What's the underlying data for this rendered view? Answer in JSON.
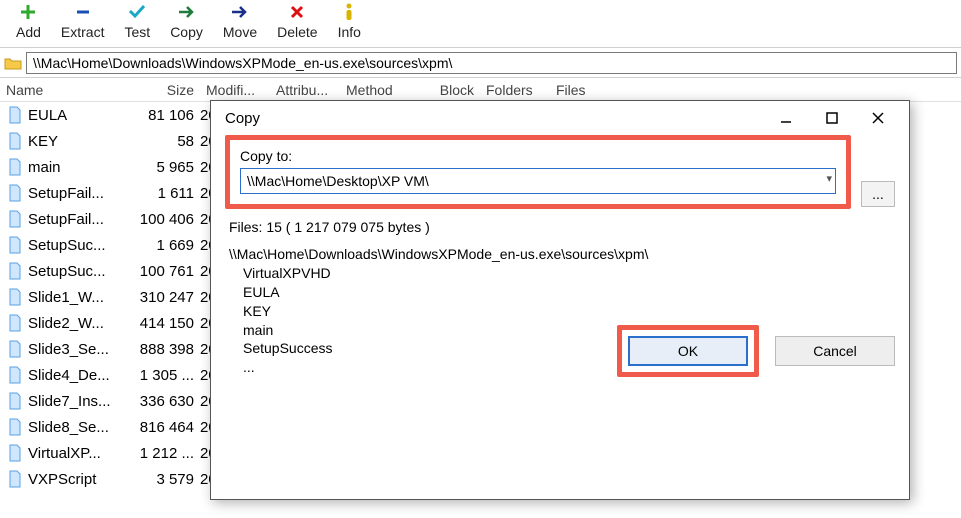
{
  "toolbar": {
    "add": "Add",
    "extract": "Extract",
    "test": "Test",
    "copy": "Copy",
    "move": "Move",
    "delete": "Delete",
    "info": "Info"
  },
  "address": "\\\\Mac\\Home\\Downloads\\WindowsXPMode_en-us.exe\\sources\\xpm\\",
  "columns": {
    "name": "Name",
    "size": "Size",
    "modified": "Modifi...",
    "attributes": "Attribu...",
    "method": "Method",
    "block": "Block",
    "folders": "Folders",
    "files": "Files"
  },
  "rows": [
    {
      "name": "EULA",
      "size": "81 106",
      "mod": "20"
    },
    {
      "name": "KEY",
      "size": "58",
      "mod": "20"
    },
    {
      "name": "main",
      "size": "5 965",
      "mod": "20"
    },
    {
      "name": "SetupFail...",
      "size": "1 611",
      "mod": "20"
    },
    {
      "name": "SetupFail...",
      "size": "100 406",
      "mod": "20"
    },
    {
      "name": "SetupSuc...",
      "size": "1 669",
      "mod": "20"
    },
    {
      "name": "SetupSuc...",
      "size": "100 761",
      "mod": "20"
    },
    {
      "name": "Slide1_W...",
      "size": "310 247",
      "mod": "20"
    },
    {
      "name": "Slide2_W...",
      "size": "414 150",
      "mod": "20"
    },
    {
      "name": "Slide3_Se...",
      "size": "888 398",
      "mod": "20"
    },
    {
      "name": "Slide4_De...",
      "size": "1 305 ...",
      "mod": "20"
    },
    {
      "name": "Slide7_Ins...",
      "size": "336 630",
      "mod": "20"
    },
    {
      "name": "Slide8_Se...",
      "size": "816 464",
      "mod": "20"
    },
    {
      "name": "VirtualXP...",
      "size": "1 212 ...",
      "mod": "20"
    },
    {
      "name": "VXPScript",
      "size": "3 579",
      "mod": "20"
    }
  ],
  "dialog": {
    "title": "Copy",
    "copy_to_label": "Copy to:",
    "copy_to_value": "\\\\Mac\\Home\\Desktop\\XP VM\\",
    "browse": "...",
    "summary": "Files: 15    ( 1 217 079 075 bytes )",
    "source_path": "\\\\Mac\\Home\\Downloads\\WindowsXPMode_en-us.exe\\sources\\xpm\\",
    "items": [
      "VirtualXPVHD",
      "EULA",
      "KEY",
      "main",
      "SetupSuccess",
      "..."
    ],
    "ok": "OK",
    "cancel": "Cancel"
  }
}
